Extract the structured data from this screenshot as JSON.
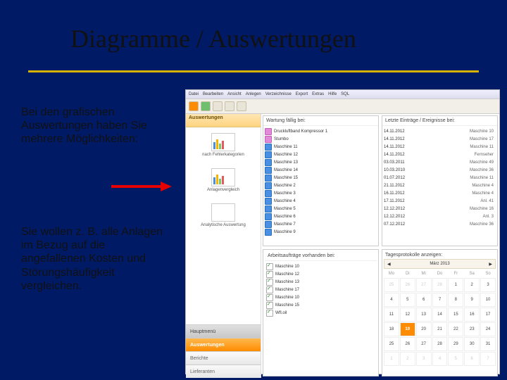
{
  "title": "Diagramme / Auswertungen",
  "para1": "Bei den grafischen Auswertungen haben Sie mehrere Möglichkeiten:",
  "para2": "Sie wollen z. B. alle Anlagen im Bezug auf die angefallenen Kosten und Störungshäufigkeit vergleichen.",
  "menu": [
    "Datei",
    "Bearbeiten",
    "Ansicht",
    "Anlegen",
    "Verzeichnisse",
    "Export",
    "Extras",
    "Hilfe",
    "SQL"
  ],
  "sidebar": {
    "head": "Auswertungen",
    "items": [
      "nach Fehlerkategorien",
      "Anlagenvergleich",
      "Analytische Auswertung"
    ],
    "nav": [
      "Hauptmenü",
      "Auswertungen",
      "Berichte",
      "Lieferanten"
    ]
  },
  "panels": {
    "left_head": "Wartung fällig bei:",
    "left_list": [
      "Druckluftband Kompressor 1",
      "Stumbo",
      "Maschine 11",
      "Maschine 12",
      "Maschine 13",
      "Maschine 14",
      "Maschine 15",
      "Maschine 2",
      "Maschine 3",
      "Maschine 4",
      "Maschine 5",
      "Maschine 6",
      "Maschine 7",
      "Maschine 9"
    ],
    "right_head": "Letzte Einträge / Ereignisse bei:",
    "right_list": [
      {
        "d": "14.11.2012",
        "m": "Maschine 10"
      },
      {
        "d": "14.11.2012",
        "m": "Maschine 17"
      },
      {
        "d": "14.11.2012",
        "m": "Maschine 11"
      },
      {
        "d": "14.11.2012",
        "m": "Fernseher"
      },
      {
        "d": "03.03.2011",
        "m": "Maschine 49"
      },
      {
        "d": "10.03.2010",
        "m": "Maschine 36"
      },
      {
        "d": "01.07.2012",
        "m": "Maschine 11"
      },
      {
        "d": "21.11.2012",
        "m": "Maschine 4"
      },
      {
        "d": "16.11.2012",
        "m": "Maschine 4"
      },
      {
        "d": "17.11.2012",
        "m": "Anl. 41"
      },
      {
        "d": "12.12.2012",
        "m": "Maschine 16"
      },
      {
        "d": "12.12.2012",
        "m": "Anl. 3"
      },
      {
        "d": "07.12.2012",
        "m": "Maschine 36"
      }
    ],
    "bl_head": "Arbeitsaufträge vorhanden bei:",
    "bl_list": [
      "Maschine 10",
      "Maschine 12",
      "Maschine 13",
      "Maschine 17",
      "Maschine 10",
      "Maschine 15",
      "Wfl.oil"
    ],
    "br_head": "Tagesprotokolle anzeigen:"
  },
  "calendar": {
    "month": "März 2013",
    "dow": [
      "Mo",
      "Di",
      "Mi",
      "Do",
      "Fr",
      "Sa",
      "So"
    ],
    "prefix": [
      25,
      26,
      27,
      28
    ],
    "days": 31,
    "today": 19,
    "suffix": [
      1,
      2,
      3,
      4,
      5,
      6,
      7
    ]
  }
}
